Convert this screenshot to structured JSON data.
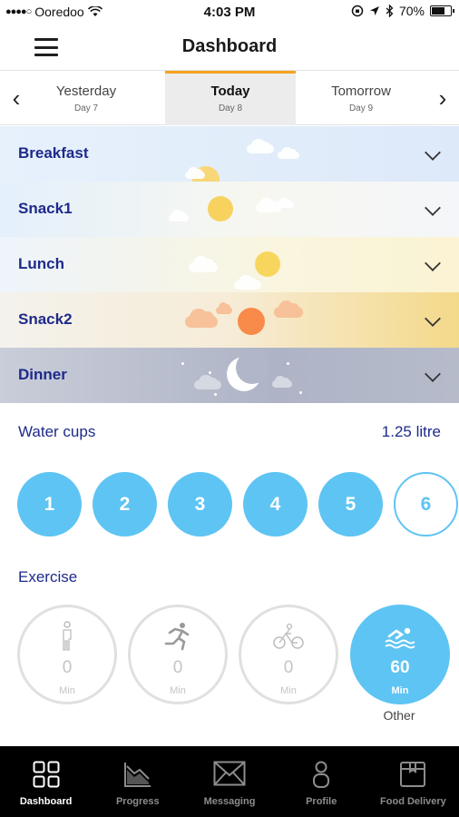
{
  "status_bar": {
    "carrier": "Ooredoo",
    "signal_dots": "●●●●○",
    "time": "4:03 PM",
    "battery_text": "70%",
    "battery_level": 0.7
  },
  "header": {
    "title": "Dashboard",
    "menu_icon": "hamburger-menu-icon"
  },
  "day_tabs": {
    "tabs": [
      {
        "name": "Yesterday",
        "day": "Day 7"
      },
      {
        "name": "Today",
        "day": "Day 8"
      },
      {
        "name": "Tomorrow",
        "day": "Day 9"
      }
    ],
    "selected": "Today",
    "accent_color": "#f5a21d"
  },
  "meals": [
    {
      "label": "Breakfast"
    },
    {
      "label": "Snack1"
    },
    {
      "label": "Lunch"
    },
    {
      "label": "Snack2"
    },
    {
      "label": "Dinner"
    }
  ],
  "water": {
    "title": "Water cups",
    "amount": "1.25 litre",
    "cups": [
      "1",
      "2",
      "3",
      "4",
      "5",
      "6"
    ],
    "filled_count": 5,
    "color": "#5ec4f3"
  },
  "exercise": {
    "title": "Exercise",
    "items": [
      {
        "icon": "walking-icon",
        "value": "0",
        "unit": "Min"
      },
      {
        "icon": "running-icon",
        "value": "0",
        "unit": "Min"
      },
      {
        "icon": "cycling-icon",
        "value": "0",
        "unit": "Min"
      },
      {
        "icon": "swimming-icon",
        "value": "60",
        "unit": "Min",
        "label": "Other"
      }
    ]
  },
  "bottom_nav": {
    "items": [
      {
        "label": "Dashboard",
        "icon": "grid-icon"
      },
      {
        "label": "Progress",
        "icon": "chart-icon"
      },
      {
        "label": "Messaging",
        "icon": "envelope-icon"
      },
      {
        "label": "Profile",
        "icon": "person-icon"
      },
      {
        "label": "Food Delivery",
        "icon": "package-icon"
      }
    ],
    "active": "Dashboard"
  }
}
